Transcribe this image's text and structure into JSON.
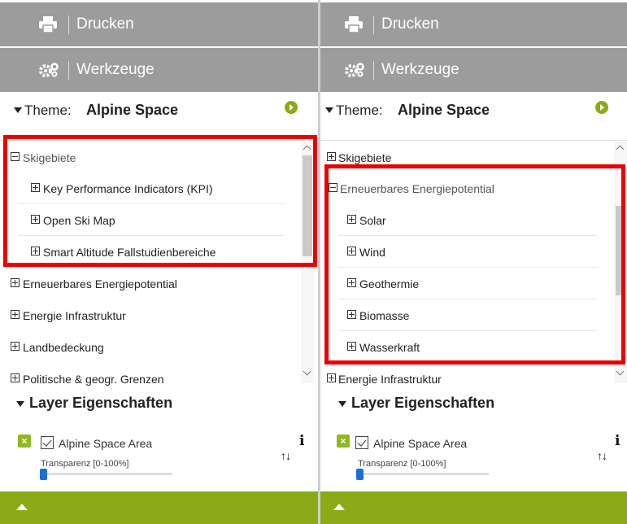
{
  "panels": [
    {
      "print_label": "Drucken",
      "tools_label": "Werkzeuge",
      "theme_prefix": "Theme:",
      "theme_name": "Alpine Space",
      "tree": [
        {
          "label": "Skigebiete",
          "state": "expanded"
        },
        {
          "label": "Key Performance Indicators (KPI)",
          "state": "collapsed"
        },
        {
          "label": "Open Ski Map",
          "state": "collapsed"
        },
        {
          "label": "Smart Altitude Fallstudienbereiche",
          "state": "collapsed"
        },
        {
          "label": "Erneuerbares Energiepotential",
          "state": "collapsed"
        },
        {
          "label": "Energie Infrastruktur",
          "state": "collapsed"
        },
        {
          "label": "Landbedeckung",
          "state": "collapsed"
        },
        {
          "label": "Politische & geogr. Grenzen",
          "state": "collapsed"
        }
      ],
      "layer_section_title": "Layer Eigenschaften",
      "layer_name": "Alpine Space Area",
      "transparency_label": "Transparenz [0-100%]",
      "transparency_value": 0
    },
    {
      "print_label": "Drucken",
      "tools_label": "Werkzeuge",
      "theme_prefix": "Theme:",
      "theme_name": "Alpine Space",
      "tree": [
        {
          "label": "Skigebiete",
          "state": "collapsed"
        },
        {
          "label": "Erneuerbares Energiepotential",
          "state": "expanded"
        },
        {
          "label": "Solar",
          "state": "collapsed"
        },
        {
          "label": "Wind",
          "state": "collapsed"
        },
        {
          "label": "Geothermie",
          "state": "collapsed"
        },
        {
          "label": "Biomasse",
          "state": "collapsed"
        },
        {
          "label": "Wasserkraft",
          "state": "collapsed"
        },
        {
          "label": "Energie Infrastruktur",
          "state": "collapsed"
        }
      ],
      "layer_section_title": "Layer Eigenschaften",
      "layer_name": "Alpine Space Area",
      "transparency_label": "Transparenz [0-100%]",
      "transparency_value": 0
    }
  ],
  "icons": {
    "print": "printer-icon",
    "tools": "gears-icon",
    "theme_go": "arrow-right-circle-icon",
    "info": "info-icon",
    "reorder": "up-down-arrows-icon",
    "remove_layer": "close-icon",
    "expand_footer": "chevron-up-icon"
  },
  "colors": {
    "header_bar": "#9c9c9c",
    "accent_green": "#8aaa16",
    "highlight_red": "#ee0000",
    "slider_blue": "#1b6fd6"
  }
}
